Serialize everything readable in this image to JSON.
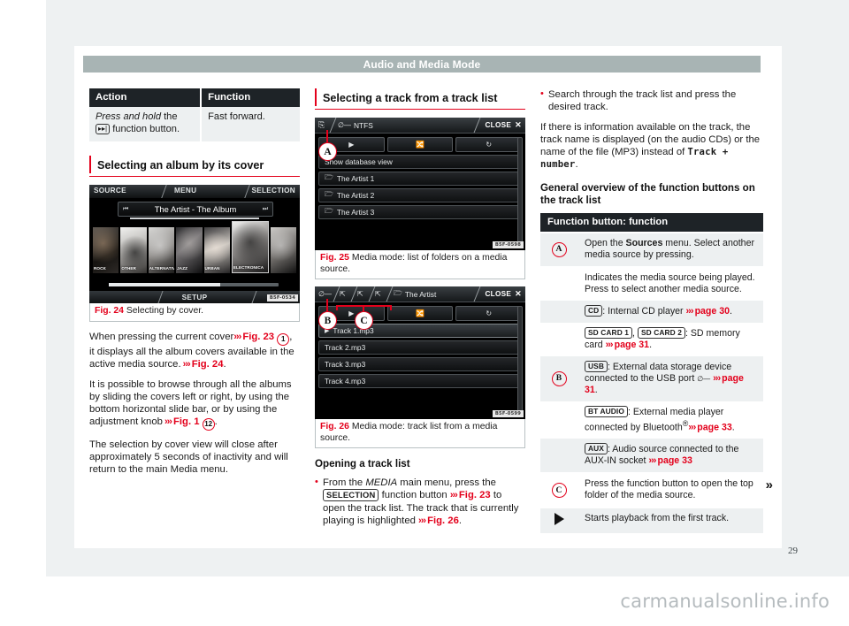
{
  "document": {
    "running_head": "Audio and Media Mode",
    "page_number": "29",
    "watermark": "carmanualsonline.info"
  },
  "col1": {
    "table1": {
      "headers": [
        "Action",
        "Function"
      ],
      "rows": [
        {
          "action_prefix": "Press and hold",
          "action_mid": " the ",
          "action_key": "▸▸|",
          "action_suffix": " function button.",
          "function": "Fast forward."
        }
      ]
    },
    "section_heading": "Selecting an album by its cover",
    "figure24": {
      "screen": {
        "source_label": "SOURCE",
        "menu_label": "MENU",
        "selection_label": "SELECTION",
        "now_playing": "The Artist - The Album",
        "setup_label": "SETUP",
        "ref_code": "B5F-0534",
        "covers": [
          {
            "name": "ROCK"
          },
          {
            "name": "OTHER"
          },
          {
            "name": "ALTERNATIVE"
          },
          {
            "name": "JAZZ"
          },
          {
            "name": "URBAN"
          },
          {
            "name": "ELECTRONICA"
          },
          {
            "name": ""
          }
        ]
      },
      "caption_label": "Fig. 24",
      "caption_text": "Selecting by cover."
    },
    "paragraphs": {
      "p1_a": "When pressing the current cover",
      "p1_ref": "Fig. 23",
      "p1_num": "1",
      "p1_b": ", it displays all the album covers available in the active media source.",
      "p1_ref2": "Fig. 24",
      "p1_c": ".",
      "p2_a": "It is possible to browse through all the albums by sliding the covers left or right, by using the bottom horizontal slide bar, or by using the adjustment knob",
      "p2_ref": "Fig. 1",
      "p2_num": "12",
      "p2_b": ".",
      "p3": "The selection by cover view will close after approximately 5 seconds of inactivity and will return to the main Media menu."
    }
  },
  "col2": {
    "section_heading": "Selecting a track from a track list",
    "figure25": {
      "screen": {
        "source_tab": "NTFS",
        "close_label": "CLOSE",
        "play_icon": "play-icon",
        "shuffle_icon": "shuffle-icon",
        "repeat_icon": "repeat-icon",
        "rows": [
          "Show database view",
          "The Artist 1",
          "The Artist 2",
          "The Artist 3"
        ],
        "callouts": [
          "A"
        ],
        "ref_code": "B5F-0598"
      },
      "caption_label": "Fig. 25",
      "caption_text": "Media mode: list of folders on a media source."
    },
    "figure26": {
      "screen": {
        "breadcrumb_tabs": [
          "usb-icon",
          "folder-up-icon",
          "folder-up-icon",
          "folder-up-icon"
        ],
        "current_folder": "The Artist",
        "close_label": "CLOSE",
        "rows": [
          "Track 1.mp3",
          "Track 2.mp3",
          "Track 3.mp3",
          "Track 4.mp3"
        ],
        "callouts": [
          "B",
          "C"
        ],
        "ref_code": "B5F-0599"
      },
      "caption_label": "Fig. 26",
      "caption_text": "Media mode: track list from a media source."
    },
    "subheading": "Opening a track list",
    "bullet1_a": "From the ",
    "bullet1_media": "MEDIA",
    "bullet1_b": " main menu, press the ",
    "bullet1_key": "SELECTION",
    "bullet1_c": " function button ",
    "bullet1_ref": "Fig. 23",
    "bullet1_d": " to open the track list. The track that is currently playing is highlighted ",
    "bullet1_ref2": "Fig. 26",
    "bullet1_e": "."
  },
  "col3": {
    "bullet1": "Search through the track list and press the desired track.",
    "para_a": "If there is information available on the track, the track name is displayed (on the audio CDs) or the name of the file (MP3) instead of ",
    "para_mono": "Track + number",
    "para_b": ".",
    "subheading": "General overview of the function buttons on the track list",
    "table": {
      "header": "Function button: function",
      "rows": [
        {
          "key": "A",
          "key_type": "circle",
          "text_a": "Open the ",
          "text_bold": "Sources",
          "text_b": " menu. Select another media source by pressing."
        },
        {
          "key": "B",
          "key_type": "circle",
          "lines": [
            {
              "cap": "",
              "text": "Indicates the media source being played. Press to select another media source."
            },
            {
              "cap": "CD",
              "text": ": Internal CD player ",
              "ref": "page 30",
              "tail": "."
            },
            {
              "cap": "SD CARD 1",
              "cap2": "SD CARD 2",
              "text": ": SD memory card ",
              "ref": "page 31",
              "tail": "."
            },
            {
              "cap": "USB",
              "text": ": External data storage device connected to the USB port ",
              "icon": "usb-icon",
              "ref": "page 31",
              "tail": "."
            },
            {
              "cap": "BT AUDIO",
              "text": ": External media player connected by Bluetooth",
              "sup": "®",
              "ref": "page 33",
              "tail": "."
            },
            {
              "cap": "AUX",
              "text": ": Audio source connected to the AUX-IN socket ",
              "ref": "page 33",
              "tail": ""
            }
          ]
        },
        {
          "key": "C",
          "key_type": "circle",
          "text_a": "Press the function button to open the top folder of the media source."
        },
        {
          "key": "play",
          "key_type": "triangle",
          "text_a": "Starts playback from the first track."
        }
      ]
    },
    "continuation_marker": "»"
  },
  "colors": {
    "accent_red": "#e3001b",
    "header_bar": "#a8b4b4",
    "table_header": "#1e2327",
    "page_bg": "#eef1f2",
    "table_row": "#edf0f1"
  }
}
